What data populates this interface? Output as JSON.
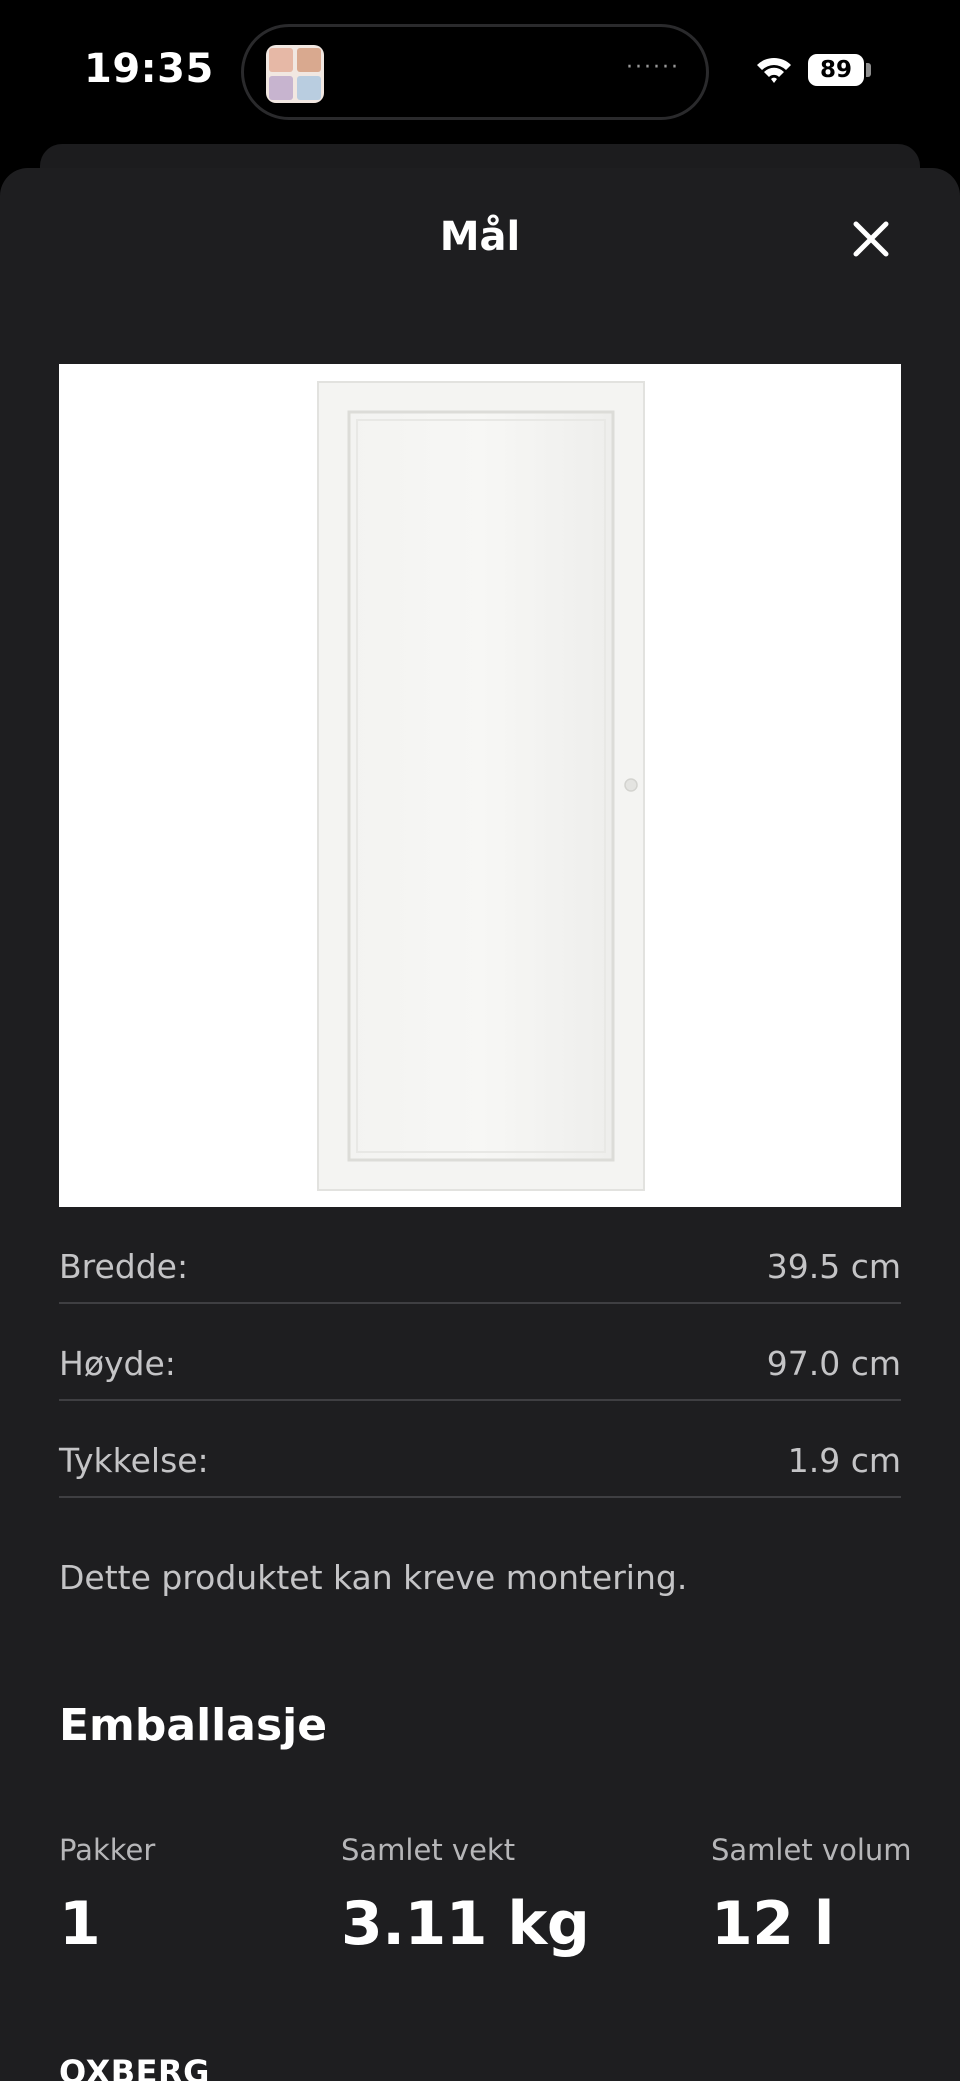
{
  "status_bar": {
    "time": "19:35",
    "island_indicator": "······",
    "battery_level": "89",
    "icons": [
      "wifi-icon",
      "battery-icon"
    ]
  },
  "sheet": {
    "title": "Mål",
    "close_icon": "close-icon"
  },
  "dimensions": [
    {
      "label": "Bredde:",
      "value": "39.5 cm"
    },
    {
      "label": "Høyde:",
      "value": "97.0 cm"
    },
    {
      "label": "Tykkelse:",
      "value": "1.9 cm"
    }
  ],
  "assembly_note": "Dette produktet kan kreve montering.",
  "packaging": {
    "title": "Emballasje",
    "stats": [
      {
        "label": "Pakker",
        "value": "1"
      },
      {
        "label": "Samlet vekt",
        "value": "3.11 kg"
      },
      {
        "label": "Samlet volum",
        "value": "12 l"
      }
    ]
  },
  "product_name": "OXBERG",
  "colors": {
    "sheet_background": "#1e1e20",
    "divider": "#3f3f42",
    "secondary_text": "#c4c4c6"
  }
}
